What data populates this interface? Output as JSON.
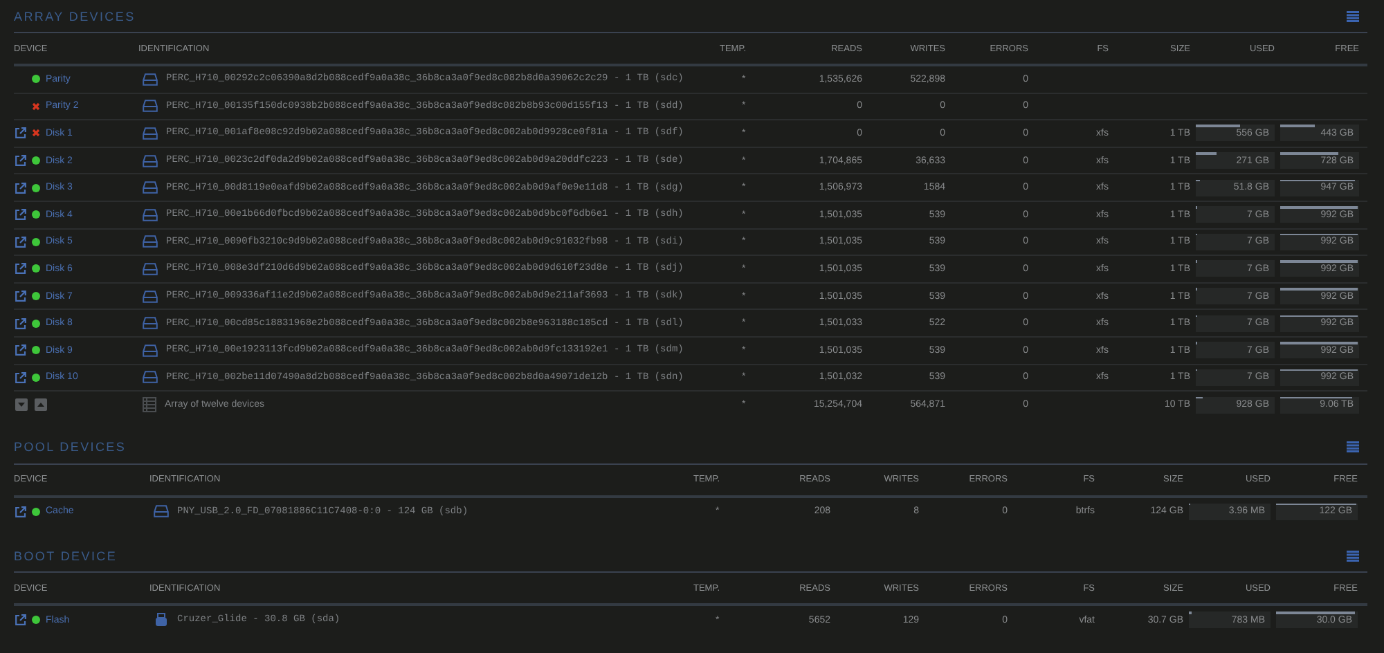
{
  "sections": [
    {
      "title": "ARRAY DEVICES",
      "columns": [
        "DEVICE",
        "IDENTIFICATION",
        "TEMP.",
        "READS",
        "WRITES",
        "ERRORS",
        "FS",
        "SIZE",
        "USED",
        "FREE"
      ],
      "rows": [
        {
          "device": "Parity",
          "error": false,
          "link": false,
          "kind": "drive",
          "identification": "PERC_H710_00292c2c06390a8d2b088cedf9a0a38c_36b8ca3a0f9ed8c082b8d0a39062c2c29 - 1 TB (sdc)",
          "temp": "*",
          "reads": "1,535,626",
          "writes": "522,898",
          "errors": "0"
        },
        {
          "device": "Parity 2",
          "error": true,
          "link": false,
          "kind": "drive",
          "identification": "PERC_H710_00135f150dc0938b2b088cedf9a0a38c_36b8ca3a0f9ed8c082b8b93c00d155f13 - 1 TB (sdd)",
          "temp": "*",
          "reads": "0",
          "writes": "0",
          "errors": "0"
        },
        {
          "device": "Disk 1",
          "error": true,
          "link": true,
          "kind": "drive",
          "identification": "PERC_H710_001af8e08c92d9b02a088cedf9a0a38c_36b8ca3a0f9ed8c002ab0d9928ce0f81a - 1 TB (sdf)",
          "temp": "*",
          "reads": "0",
          "writes": "0",
          "errors": "0",
          "fs": "xfs",
          "size": "1 TB",
          "used": {
            "text": "556 GB",
            "level": 0.56
          },
          "free": {
            "text": "443 GB",
            "level": 0.44
          }
        },
        {
          "device": "Disk 2",
          "error": false,
          "link": true,
          "kind": "drive",
          "identification": "PERC_H710_0023c2df0da2d9b02a088cedf9a0a38c_36b8ca3a0f9ed8c002ab0d9a20ddfc223 - 1 TB (sde)",
          "temp": "*",
          "reads": "1,704,865",
          "writes": "36,633",
          "errors": "0",
          "fs": "xfs",
          "size": "1 TB",
          "used": {
            "text": "271 GB",
            "level": 0.27
          },
          "free": {
            "text": "728 GB",
            "level": 0.73
          }
        },
        {
          "device": "Disk 3",
          "error": false,
          "link": true,
          "kind": "drive",
          "identification": "PERC_H710_00d8119e0eafd9b02a088cedf9a0a38c_36b8ca3a0f9ed8c002ab0d9af0e9e11d8 - 1 TB (sdg)",
          "temp": "*",
          "reads": "1,506,973",
          "writes": "1584",
          "errors": "0",
          "fs": "xfs",
          "size": "1 TB",
          "used": {
            "text": "51.8 GB",
            "level": 0.05
          },
          "free": {
            "text": "947 GB",
            "level": 0.95
          }
        },
        {
          "device": "Disk 4",
          "error": false,
          "link": true,
          "kind": "drive",
          "identification": "PERC_H710_00e1b66d0fbcd9b02a088cedf9a0a38c_36b8ca3a0f9ed8c002ab0d9bc0f6db6e1 - 1 TB (sdh)",
          "temp": "*",
          "reads": "1,501,035",
          "writes": "539",
          "errors": "0",
          "fs": "xfs",
          "size": "1 TB",
          "used": {
            "text": "7 GB",
            "level": 0.01
          },
          "free": {
            "text": "992 GB",
            "level": 0.99
          }
        },
        {
          "device": "Disk 5",
          "error": false,
          "link": true,
          "kind": "drive",
          "identification": "PERC_H710_0090fb3210c9d9b02a088cedf9a0a38c_36b8ca3a0f9ed8c002ab0d9c91032fb98 - 1 TB (sdi)",
          "temp": "*",
          "reads": "1,501,035",
          "writes": "539",
          "errors": "0",
          "fs": "xfs",
          "size": "1 TB",
          "used": {
            "text": "7 GB",
            "level": 0.01
          },
          "free": {
            "text": "992 GB",
            "level": 0.99
          }
        },
        {
          "device": "Disk 6",
          "error": false,
          "link": true,
          "kind": "drive",
          "identification": "PERC_H710_008e3df210d6d9b02a088cedf9a0a38c_36b8ca3a0f9ed8c002ab0d9d610f23d8e - 1 TB (sdj)",
          "temp": "*",
          "reads": "1,501,035",
          "writes": "539",
          "errors": "0",
          "fs": "xfs",
          "size": "1 TB",
          "used": {
            "text": "7 GB",
            "level": 0.01
          },
          "free": {
            "text": "992 GB",
            "level": 0.99
          }
        },
        {
          "device": "Disk 7",
          "error": false,
          "link": true,
          "kind": "drive",
          "identification": "PERC_H710_009336af11e2d9b02a088cedf9a0a38c_36b8ca3a0f9ed8c002ab0d9e211af3693 - 1 TB (sdk)",
          "temp": "*",
          "reads": "1,501,035",
          "writes": "539",
          "errors": "0",
          "fs": "xfs",
          "size": "1 TB",
          "used": {
            "text": "7 GB",
            "level": 0.01
          },
          "free": {
            "text": "992 GB",
            "level": 0.99
          }
        },
        {
          "device": "Disk 8",
          "error": false,
          "link": true,
          "kind": "drive",
          "identification": "PERC_H710_00cd85c18831968e2b088cedf9a0a38c_36b8ca3a0f9ed8c002b8e963188c185cd - 1 TB (sdl)",
          "temp": "*",
          "reads": "1,501,033",
          "writes": "522",
          "errors": "0",
          "fs": "xfs",
          "size": "1 TB",
          "used": {
            "text": "7 GB",
            "level": 0.01
          },
          "free": {
            "text": "992 GB",
            "level": 0.99
          }
        },
        {
          "device": "Disk 9",
          "error": false,
          "link": true,
          "kind": "drive",
          "identification": "PERC_H710_00e1923113fcd9b02a088cedf9a0a38c_36b8ca3a0f9ed8c002ab0d9fc133192e1 - 1 TB (sdm)",
          "temp": "*",
          "reads": "1,501,035",
          "writes": "539",
          "errors": "0",
          "fs": "xfs",
          "size": "1 TB",
          "used": {
            "text": "7 GB",
            "level": 0.01
          },
          "free": {
            "text": "992 GB",
            "level": 0.99
          }
        },
        {
          "device": "Disk 10",
          "error": false,
          "link": true,
          "kind": "drive",
          "identification": "PERC_H710_002be11d07490a8d2b088cedf9a0a38c_36b8ca3a0f9ed8c002b8d0a49071de12b - 1 TB (sdn)",
          "temp": "*",
          "reads": "1,501,032",
          "writes": "539",
          "errors": "0",
          "fs": "xfs",
          "size": "1 TB",
          "used": {
            "text": "7 GB",
            "level": 0.01
          },
          "free": {
            "text": "992 GB",
            "level": 0.99
          }
        }
      ],
      "total": {
        "label": "Array of twelve devices",
        "temp": "*",
        "reads": "15,254,704",
        "writes": "564,871",
        "errors": "0",
        "size": "10 TB",
        "used": {
          "text": "928 GB",
          "level": 0.09
        },
        "free": {
          "text": "9.06 TB",
          "level": 0.91
        }
      }
    },
    {
      "title": "POOL DEVICES",
      "columns": [
        "DEVICE",
        "IDENTIFICATION",
        "TEMP.",
        "READS",
        "WRITES",
        "ERRORS",
        "FS",
        "SIZE",
        "USED",
        "FREE"
      ],
      "rows": [
        {
          "device": "Cache",
          "error": false,
          "link": true,
          "kind": "drive",
          "identification": "PNY_USB_2.0_FD_07081886C11C7408-0:0 - 124 GB (sdb)",
          "temp": "*",
          "reads": "208",
          "writes": "8",
          "errors": "0",
          "fs": "btrfs",
          "size": "124 GB",
          "used": {
            "text": "3.96 MB",
            "level": 0.01
          },
          "free": {
            "text": "122 GB",
            "level": 0.98
          }
        }
      ]
    },
    {
      "title": "BOOT DEVICE",
      "columns": [
        "DEVICE",
        "IDENTIFICATION",
        "TEMP.",
        "READS",
        "WRITES",
        "ERRORS",
        "FS",
        "SIZE",
        "USED",
        "FREE"
      ],
      "rows": [
        {
          "device": "Flash",
          "error": false,
          "link": true,
          "kind": "flash",
          "identification": "Cruzer_Glide - 30.8 GB (sda)",
          "temp": "*",
          "reads": "5652",
          "writes": "129",
          "errors": "0",
          "fs": "vfat",
          "size": "30.7 GB",
          "used": {
            "text": "783 MB",
            "level": 0.03
          },
          "free": {
            "text": "30.0 GB",
            "level": 0.97
          }
        }
      ]
    }
  ]
}
